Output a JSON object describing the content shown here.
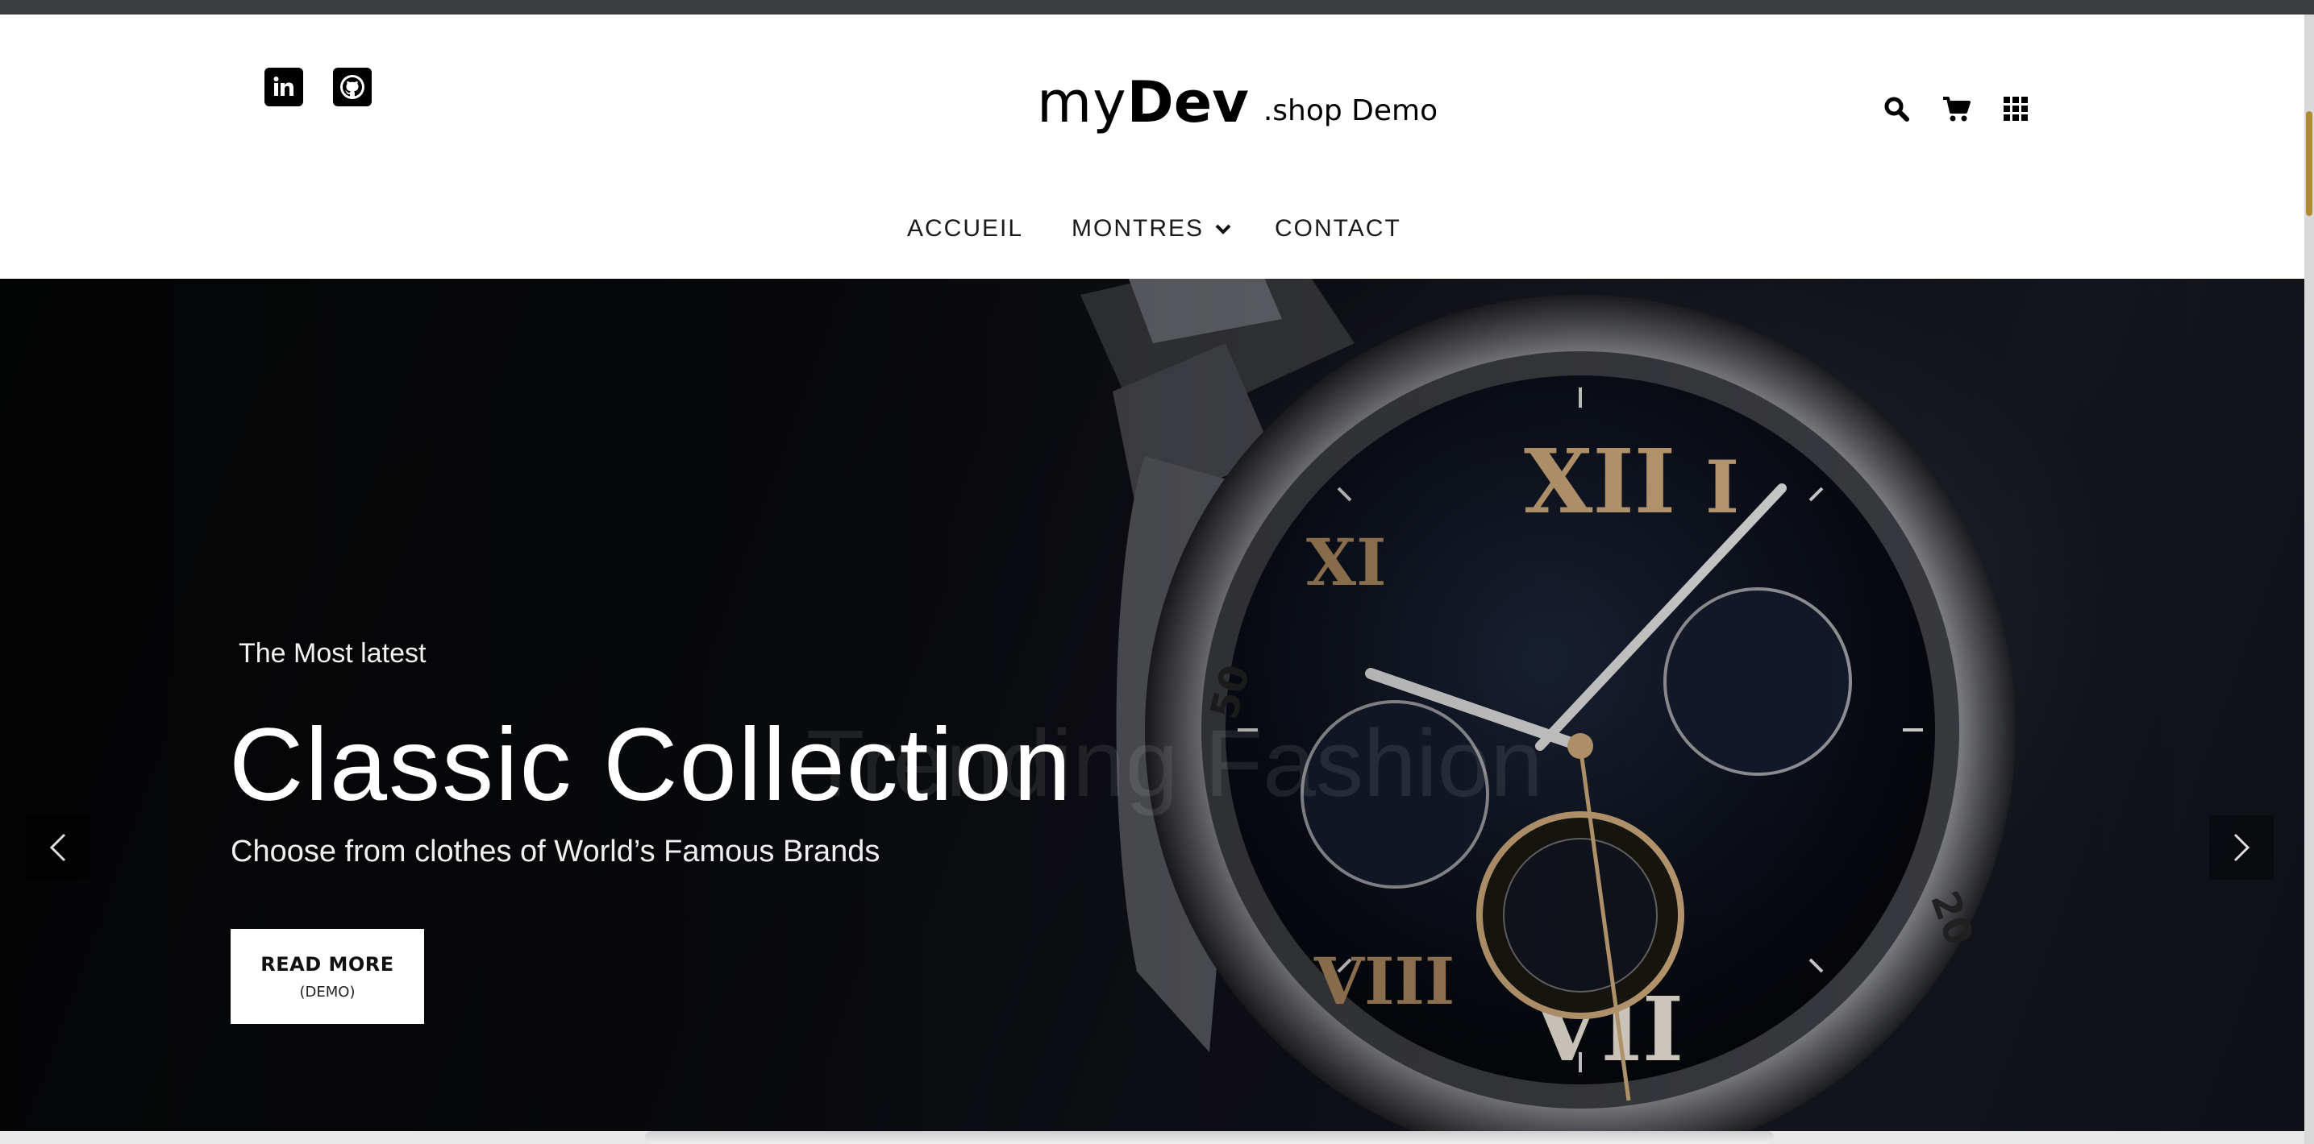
{
  "header": {
    "logo": {
      "my": "my",
      "dev": "Dev",
      "suffix": ".shop Demo"
    },
    "social": [
      {
        "icon": "linkedin-icon"
      },
      {
        "icon": "github-icon"
      }
    ],
    "tools": [
      {
        "icon": "search-icon"
      },
      {
        "icon": "cart-icon"
      },
      {
        "icon": "grid-menu-icon"
      }
    ]
  },
  "nav": {
    "items": [
      {
        "label": "ACCUEIL"
      },
      {
        "label": "MONTRES",
        "has_dropdown": true
      },
      {
        "label": "CONTACT"
      }
    ]
  },
  "hero": {
    "pre_title": "The Most latest",
    "title": "Classic Collection",
    "ghost_title": "Trending Fashion",
    "subtitle": "Choose from clothes of World’s Famous Brands",
    "cta": {
      "line1": "READ MORE",
      "line2": "(DEMO)"
    },
    "watch_numerals": {
      "top": "XII",
      "bottom": "VII",
      "bezel_50": "50",
      "bezel_20": "20"
    }
  },
  "colors": {
    "topbar": "#3a3b3f",
    "scroll_thumb": "#b08b2f",
    "hero_background": "#0b0c10",
    "cta_background": "#ffffff"
  }
}
